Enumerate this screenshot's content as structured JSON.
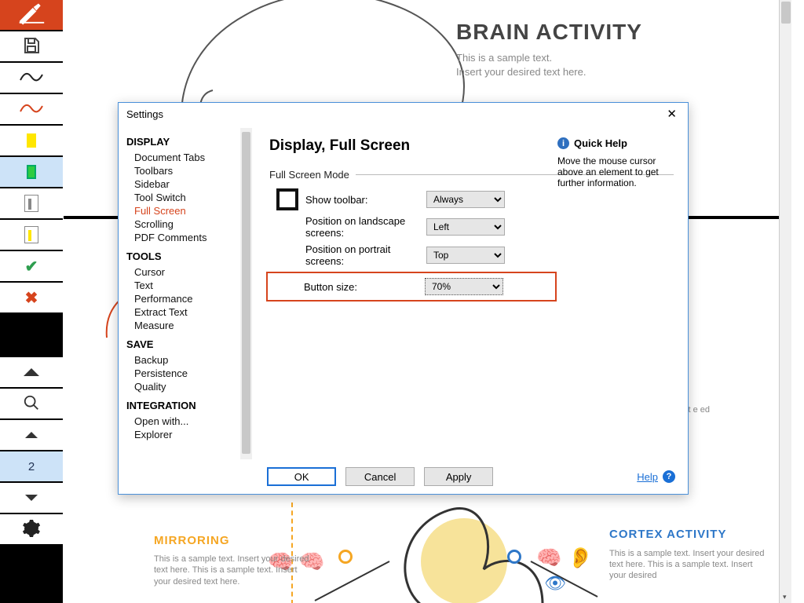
{
  "document": {
    "title": "BRAIN ACTIVITY",
    "subtitle_line1": "This is a sample text.",
    "subtitle_line2": "Insert your desired text here.",
    "mirroring": {
      "heading": "MIRRORING",
      "text": "This is a sample text. Insert your desired text here. This is a sample text. Insert your desired text here."
    },
    "cortex": {
      "heading": "CORTEX ACTIVITY",
      "text": "This is a sample text. Insert your desired text here. This is a sample text. Insert your desired"
    },
    "right_snippet": "xt e ed"
  },
  "toolbar": {
    "page_number": "2"
  },
  "dialog": {
    "title": "Settings",
    "panel_title": "Display, Full Screen",
    "group_label": "Full Screen Mode",
    "rows": {
      "show_toolbar": {
        "label": "Show toolbar:",
        "value": "Always"
      },
      "landscape": {
        "label": "Position on landscape screens:",
        "value": "Left"
      },
      "portrait": {
        "label": "Position on portrait screens:",
        "value": "Top"
      },
      "button_size": {
        "label": "Button size:",
        "value": "70%"
      }
    },
    "quick_help": {
      "title": "Quick Help",
      "text": "Move the mouse cursor above an element to get further information."
    },
    "nav": {
      "display": {
        "head": "DISPLAY",
        "items": [
          "Document Tabs",
          "Toolbars",
          "Sidebar",
          "Tool Switch",
          "Full Screen",
          "Scrolling",
          "PDF Comments"
        ]
      },
      "tools": {
        "head": "TOOLS",
        "items": [
          "Cursor",
          "Text",
          "Performance",
          "Extract Text",
          "Measure"
        ]
      },
      "save": {
        "head": "SAVE",
        "items": [
          "Backup",
          "Persistence",
          "Quality"
        ]
      },
      "integration": {
        "head": "INTEGRATION",
        "items": [
          "Open with...",
          "Explorer"
        ]
      }
    },
    "buttons": {
      "ok": "OK",
      "cancel": "Cancel",
      "apply": "Apply",
      "help": "Help"
    }
  }
}
